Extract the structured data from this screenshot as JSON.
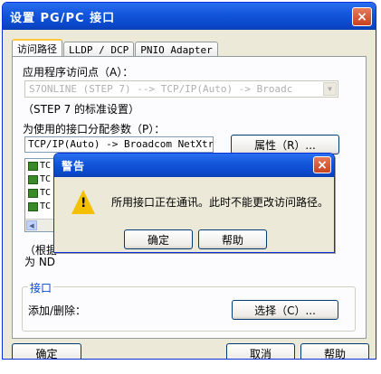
{
  "window": {
    "title": "设置 PG/PC 接口",
    "close_icon": "×"
  },
  "tabs": [
    {
      "label": "访问路径"
    },
    {
      "label": "LLDP / DCP"
    },
    {
      "label": "PNIO Adapter"
    }
  ],
  "access_point": {
    "label": "应用程序访问点（A）：",
    "value": "S7ONLINE       (STEP 7)        --> TCP/IP(Auto) -> Broadc",
    "note": "（STEP 7 的标准设置）"
  },
  "interface_param": {
    "label": "为使用的接口分配参数（P）：",
    "value": "TCP/IP(Auto) -> Broadcom NetXtreme",
    "properties_button": "属性（R）..."
  },
  "param_list": {
    "items": [
      "TC",
      "TC",
      "TC",
      "TC"
    ]
  },
  "hidden_text": {
    "line1": "（根据",
    "line2": "为 ND"
  },
  "interface_group": {
    "label": "接口",
    "add_remove_label": "添加/删除：",
    "select_button": "选择（C）..."
  },
  "bottom": {
    "ok": "确定",
    "cancel": "取消",
    "help": "帮助"
  },
  "alert": {
    "title": "警告",
    "message": "所用接口正在通讯。此时不能更改访问路径。",
    "ok": "确定",
    "help": "帮助",
    "close_icon": "×",
    "warning_glyph": "!"
  }
}
